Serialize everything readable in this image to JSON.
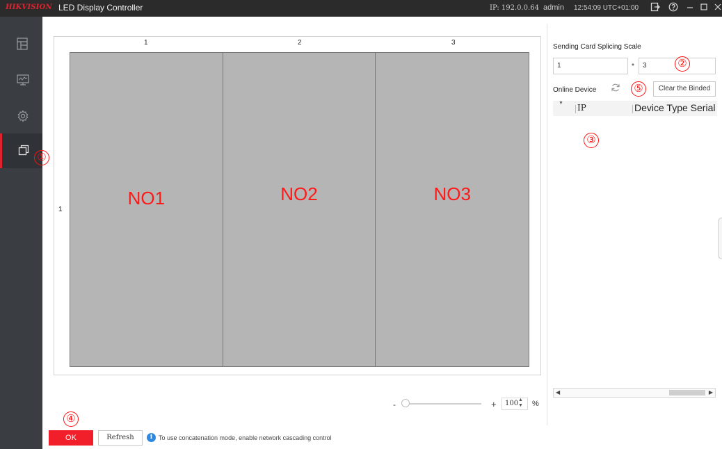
{
  "titlebar": {
    "brand": "HIKVISION",
    "app_title": "LED Display Controller",
    "ip": "IP: 192.0.0.64",
    "user": "admin",
    "clock": "12:54:09 UTC+01:00",
    "icons": [
      "logout-icon",
      "help-icon",
      "minimize-icon",
      "maximize-icon",
      "close-icon"
    ]
  },
  "sidebar": {
    "items": [
      {
        "icon": "layout-icon",
        "active": false
      },
      {
        "icon": "monitor-icon",
        "active": false
      },
      {
        "icon": "gear-icon",
        "active": false
      },
      {
        "icon": "screens-copy-icon",
        "active": true
      }
    ]
  },
  "canvas": {
    "column_labels": [
      "1",
      "2",
      "3"
    ],
    "row_labels": [
      "1"
    ],
    "screens": [
      "NO1",
      "NO2",
      "NO3"
    ]
  },
  "zoom": {
    "minus": "-",
    "plus": "+",
    "value": "100",
    "unit": "%"
  },
  "panel": {
    "title": "Sending Card Splicing Scale",
    "rows_value": "1",
    "separator": "*",
    "cols_value": "3",
    "online_label": "Online Device",
    "clear_button": "Clear the Binded",
    "table": {
      "columns": [
        "IP",
        "Device Type Serial"
      ],
      "rows": []
    }
  },
  "footer": {
    "ok": "OK",
    "refresh": "Refresh",
    "info_icon": "i",
    "info_text": "To use concatenation mode, enable network cascading control"
  },
  "annotations": [
    "①",
    "②",
    "③",
    "④",
    "⑤"
  ],
  "colors": {
    "accent": "#f01f2a",
    "sidebar": "#3a3d41",
    "titlebar": "#2b2b2b",
    "screen": "#b5b5b5",
    "annotation": "#ff1010"
  }
}
